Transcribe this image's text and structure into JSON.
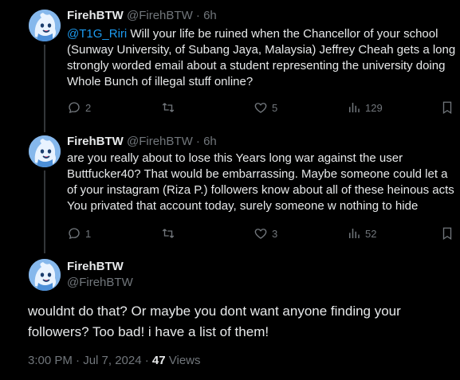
{
  "tweets": [
    {
      "display_name": "FirehBTW",
      "handle": "@FirehBTW",
      "sep": "·",
      "time": "6h",
      "mention": "@T1G_Riri",
      "lines": [
        " Will your life be ruined when the Chancellor of your school",
        "(Sunway University, of Subang Jaya, Malaysia) Jeffrey Cheah gets a long",
        "strongly worded email about a student representing the university doing",
        "Whole Bunch of illegal stuff online?"
      ],
      "reply_count": "2",
      "retweet_count": "",
      "like_count": "5",
      "view_count": "129"
    },
    {
      "display_name": "FirehBTW",
      "handle": "@FirehBTW",
      "sep": "·",
      "time": "6h",
      "lines": [
        "are you really about to lose this Years long war against the user",
        "Buttfucker40? That would be embarrassing. Maybe someone could let a",
        "of your instagram (Riza P.) followers know about all of these heinous acts",
        "You privated that account today, surely someone w nothing to hide"
      ],
      "reply_count": "1",
      "retweet_count": "",
      "like_count": "3",
      "view_count": "52"
    }
  ],
  "main_tweet": {
    "display_name": "FirehBTW",
    "handle": "@FirehBTW",
    "lines": [
      "wouldnt do that? Or maybe you dont want anyone finding your",
      "followers? Too bad! i have a list of them!"
    ],
    "timestamp": "3:00 PM · Jul 7, 2024 · ",
    "views_count": "47",
    "views_label": " Views"
  },
  "icons": {
    "reply": "reply-icon",
    "retweet": "retweet-icon",
    "like": "like-icon",
    "views": "views-icon",
    "bookmark": "bookmark-icon",
    "avatar": "avatar-image"
  },
  "colors": {
    "background": "#000000",
    "text": "#e7e9ea",
    "muted": "#71767b",
    "link": "#1d9bf0",
    "thread_line": "#333639"
  }
}
